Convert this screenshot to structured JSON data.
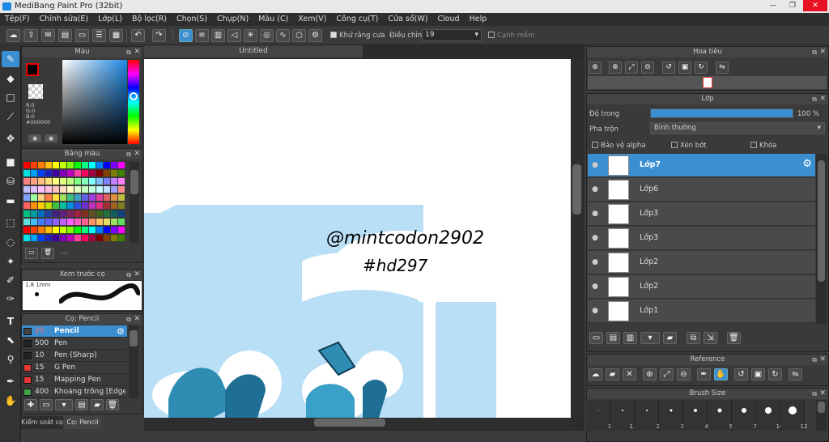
{
  "titlebar": {
    "title": "MediBang Paint Pro (32bit)"
  },
  "menu": [
    "Tệp(F)",
    "Chỉnh sửa(E)",
    "Lớp(L)",
    "Bộ lọc(R)",
    "Chọn(S)",
    "Chụp(N)",
    "Màu (C)",
    "Xem(V)",
    "Công cụ(T)",
    "Cửa sổ(W)",
    "Cloud",
    "Help"
  ],
  "toolbar": {
    "antialias_label": "Khử răng cưa",
    "adjust_label": "Điều chỉnh",
    "adjust_value": "19",
    "edge_label": "Cạnh mềm"
  },
  "color_panel": {
    "title": "Màu",
    "r": "R:0",
    "g": "G:0",
    "b": "B:0",
    "hex": "#000000",
    "accent": "#3b8fd0"
  },
  "palette_panel": {
    "title": "Bảng màu",
    "footer": "---"
  },
  "brush_preview": {
    "title": "Xem trước cọ",
    "size": "1.8 1mm"
  },
  "brush_panel": {
    "title": "Cọ: Pencil",
    "items": [
      {
        "size": "25",
        "name": "Pencil",
        "color": "#444444",
        "selected": true
      },
      {
        "size": "500",
        "name": "Pen",
        "color": "#222222"
      },
      {
        "size": "10",
        "name": "Pen (Sharp)",
        "color": "#222222"
      },
      {
        "size": "15",
        "name": "G Pen",
        "color": "#e53935"
      },
      {
        "size": "15",
        "name": "Mapping Pen",
        "color": "#e53935"
      },
      {
        "size": "400",
        "name": "Khoảng trống [Edge B",
        "color": "#43a047"
      }
    ]
  },
  "bottom_tabs": {
    "tab1": "Kiểm soát cọ",
    "tab2": "Cọ: Pencil"
  },
  "document": {
    "tab": "Untitled",
    "watermark_line1": "@mintcodon2902",
    "watermark_line2": "#hd297"
  },
  "navigator": {
    "title": "Hoa tiêu"
  },
  "layer_panel": {
    "title": "Lớp",
    "opacity_label": "Độ trong",
    "opacity_value": "100 %",
    "opacity_fraction": 1.0,
    "blend_label": "Pha trộn",
    "blend_value": "Bình thường",
    "protect_alpha": "Bảo vệ alpha",
    "clipping": "Xén bớt",
    "lock": "Khóa",
    "layers": [
      "Lớp7",
      "Lớp6",
      "Lớp3",
      "Lớp3",
      "Lớp2",
      "Lớp2",
      "Lớp1"
    ]
  },
  "reference": {
    "title": "Reference"
  },
  "brush_size": {
    "title": "Brush Size",
    "sizes": [
      "1",
      "1.5",
      "2",
      "3",
      "4",
      "5",
      "7",
      "10",
      "12"
    ]
  }
}
